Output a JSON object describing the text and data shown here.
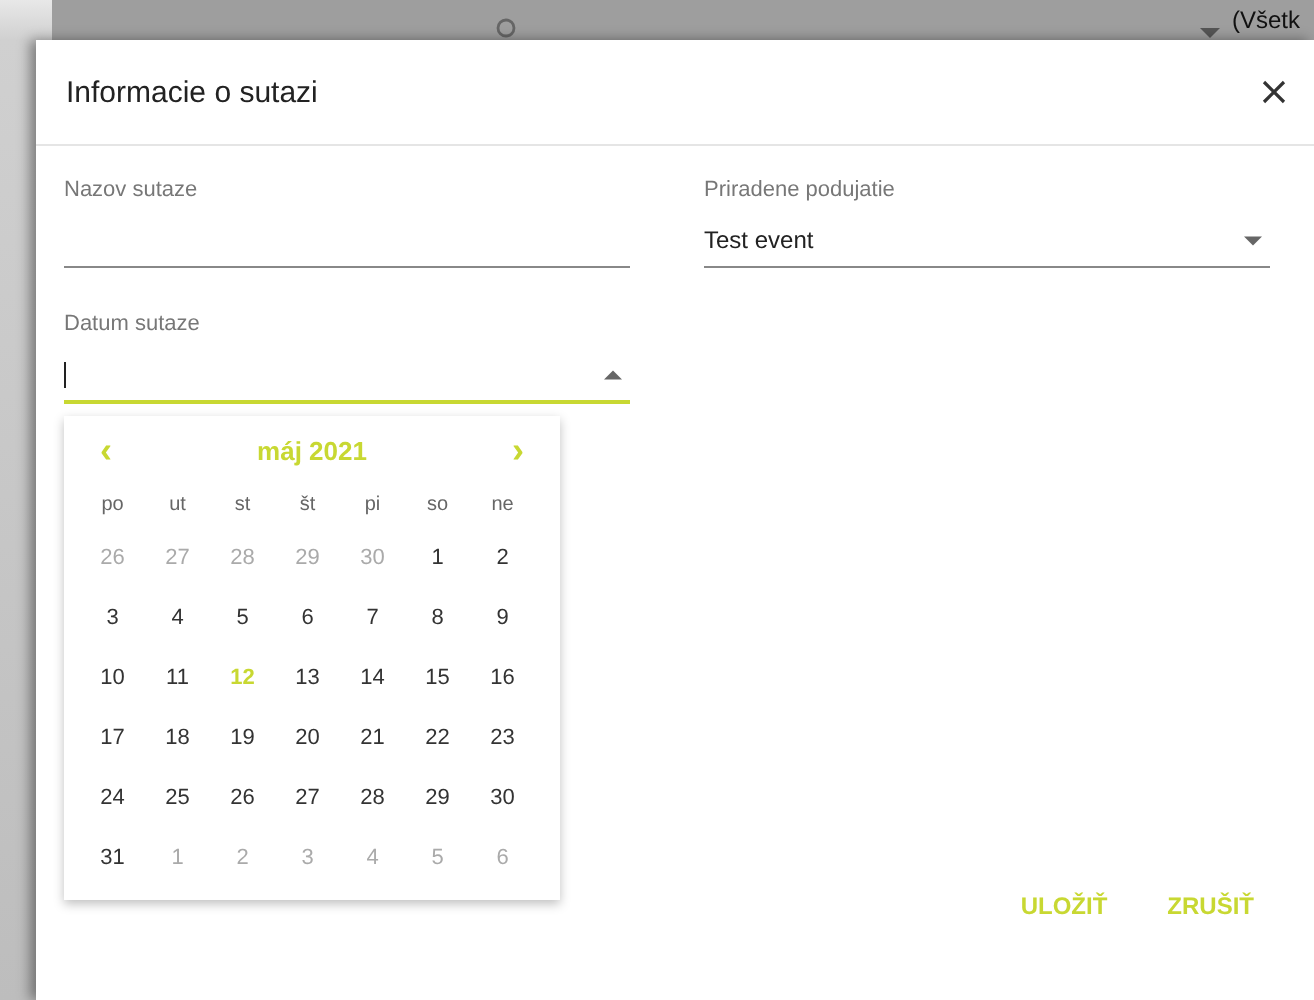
{
  "background": {
    "filter_text": "(Všetk"
  },
  "dialog": {
    "title": "Informacie o sutazi",
    "fields": [
      {
        "kind": "text",
        "label": "Nazov sutaze"
      },
      {
        "kind": "select",
        "label": "Priradene podujatie",
        "value": "Test event"
      },
      {
        "kind": "date",
        "label": "Datum sutaze",
        "focused": true,
        "expanded": true
      }
    ],
    "calendar": {
      "month": "máj 2021",
      "prev": "‹",
      "next": "›",
      "weekdays": [
        "po",
        "ut",
        "st",
        "št",
        "pi",
        "so",
        "ne"
      ],
      "days": [
        {
          "text": "26",
          "outside": true,
          "selected": false
        },
        {
          "text": "27",
          "outside": true,
          "selected": false
        },
        {
          "text": "28",
          "outside": true,
          "selected": false
        },
        {
          "text": "29",
          "outside": true,
          "selected": false
        },
        {
          "text": "30",
          "outside": true,
          "selected": false
        },
        {
          "text": "1",
          "outside": false,
          "selected": false
        },
        {
          "text": "2",
          "outside": false,
          "selected": false
        },
        {
          "text": "3",
          "outside": false,
          "selected": false
        },
        {
          "text": "4",
          "outside": false,
          "selected": false
        },
        {
          "text": "5",
          "outside": false,
          "selected": false
        },
        {
          "text": "6",
          "outside": false,
          "selected": false
        },
        {
          "text": "7",
          "outside": false,
          "selected": false
        },
        {
          "text": "8",
          "outside": false,
          "selected": false
        },
        {
          "text": "9",
          "outside": false,
          "selected": false
        },
        {
          "text": "10",
          "outside": false,
          "selected": false
        },
        {
          "text": "11",
          "outside": false,
          "selected": false
        },
        {
          "text": "12",
          "outside": false,
          "selected": true
        },
        {
          "text": "13",
          "outside": false,
          "selected": false
        },
        {
          "text": "14",
          "outside": false,
          "selected": false
        },
        {
          "text": "15",
          "outside": false,
          "selected": false
        },
        {
          "text": "16",
          "outside": false,
          "selected": false
        },
        {
          "text": "17",
          "outside": false,
          "selected": false
        },
        {
          "text": "18",
          "outside": false,
          "selected": false
        },
        {
          "text": "19",
          "outside": false,
          "selected": false
        },
        {
          "text": "20",
          "outside": false,
          "selected": false
        },
        {
          "text": "21",
          "outside": false,
          "selected": false
        },
        {
          "text": "22",
          "outside": false,
          "selected": false
        },
        {
          "text": "23",
          "outside": false,
          "selected": false
        },
        {
          "text": "24",
          "outside": false,
          "selected": false
        },
        {
          "text": "25",
          "outside": false,
          "selected": false
        },
        {
          "text": "26",
          "outside": false,
          "selected": false
        },
        {
          "text": "27",
          "outside": false,
          "selected": false
        },
        {
          "text": "28",
          "outside": false,
          "selected": false
        },
        {
          "text": "29",
          "outside": false,
          "selected": false
        },
        {
          "text": "30",
          "outside": false,
          "selected": false
        },
        {
          "text": "31",
          "outside": false,
          "selected": false
        },
        {
          "text": "1",
          "outside": true,
          "selected": false
        },
        {
          "text": "2",
          "outside": true,
          "selected": false
        },
        {
          "text": "3",
          "outside": true,
          "selected": false
        },
        {
          "text": "4",
          "outside": true,
          "selected": false
        },
        {
          "text": "5",
          "outside": true,
          "selected": false
        },
        {
          "text": "6",
          "outside": true,
          "selected": false
        }
      ]
    },
    "buttons": [
      "ULOŽIŤ",
      "ZRUŠIŤ"
    ]
  }
}
